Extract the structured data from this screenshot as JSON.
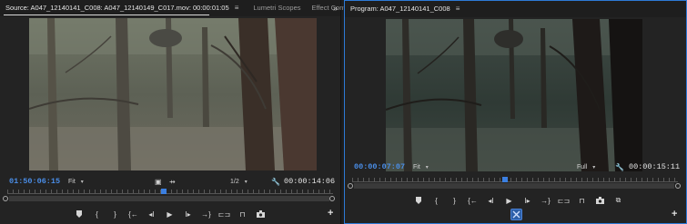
{
  "source": {
    "tabs": [
      {
        "label": "Source: A047_12140141_C008: A047_12140149_C017.mov: 00:00:01:05"
      },
      {
        "label": "Lumetri Scopes"
      },
      {
        "label": "Effect Controls"
      }
    ],
    "overflow_icon": "double-chevron-right-icon",
    "timecode_current": "01:50:06:15",
    "zoom": "Fit",
    "resolution": "1/2",
    "timecode_duration": "00:00:14:06",
    "playhead_fraction": 0.48
  },
  "program": {
    "tab_label": "Program: A047_12140141_C008",
    "timecode_current": "00:00:07:07",
    "zoom": "Fit",
    "resolution": "Full",
    "timecode_duration": "00:00:15:11",
    "playhead_fraction": 0.47
  },
  "colors": {
    "accent_blue": "#3b7fe0",
    "timecode_blue": "#4a8ee8",
    "panel_bg": "#232323",
    "active_border": "#2d7ad6"
  }
}
